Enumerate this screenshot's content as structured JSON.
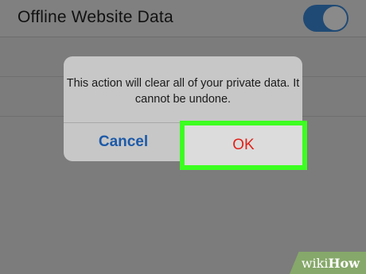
{
  "settings": {
    "row_label": "Offline Website Data",
    "toggle_on": true
  },
  "dialog": {
    "message": "This action will clear all of your private data. It cannot be undone.",
    "cancel_label": "Cancel",
    "ok_label": "OK"
  },
  "watermark": {
    "wiki": "wiki",
    "how": "How"
  },
  "colors": {
    "highlight": "#3cff20",
    "ok_text": "#e0221a",
    "cancel_text": "#1d5aa8",
    "toggle_on": "#1f4a75"
  }
}
